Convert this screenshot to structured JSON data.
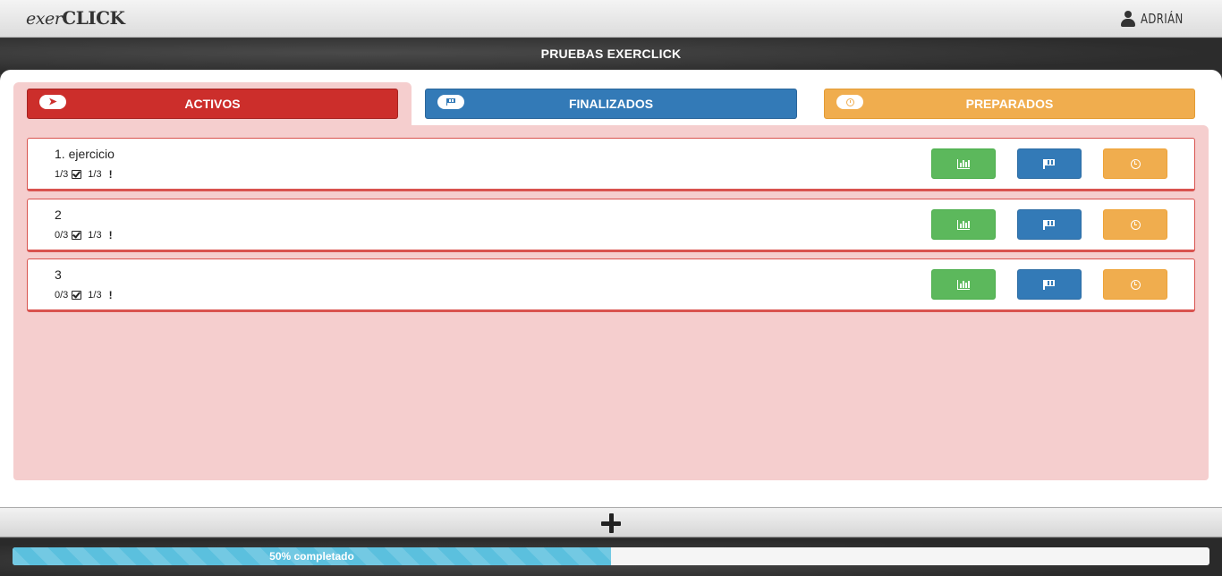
{
  "navbar": {
    "brand_prefix": "exer",
    "brand_suffix": "CLICK",
    "user_name": "ADRIÁN"
  },
  "header": {
    "title": "PRUEBAS EXERCLICK"
  },
  "tabs": [
    {
      "label": "ACTIVOS",
      "icon": "paper-plane-icon",
      "color": "#cc2e2b",
      "active": true
    },
    {
      "label": "FINALIZADOS",
      "icon": "flag-checkered-icon",
      "color": "#337ab7",
      "active": false
    },
    {
      "label": "PREPARADOS",
      "icon": "clock-icon",
      "color": "#f0ad4e",
      "active": false
    }
  ],
  "items": [
    {
      "title": "1. ejercicio",
      "done": "1/3",
      "pending": "1/3"
    },
    {
      "title": "2",
      "done": "0/3",
      "pending": "1/3"
    },
    {
      "title": "3",
      "done": "0/3",
      "pending": "1/3"
    }
  ],
  "item_actions": {
    "stats_icon": "bar-chart-icon",
    "finish_icon": "flag-checkered-icon",
    "prepare_icon": "clock-icon",
    "stats_color": "#5cb85c",
    "finish_color": "#337ab7",
    "prepare_color": "#f0ad4e"
  },
  "add_button": {
    "icon": "plus-icon"
  },
  "progress": {
    "percent": 50,
    "label": "50% completado",
    "color": "#5bc0de"
  }
}
